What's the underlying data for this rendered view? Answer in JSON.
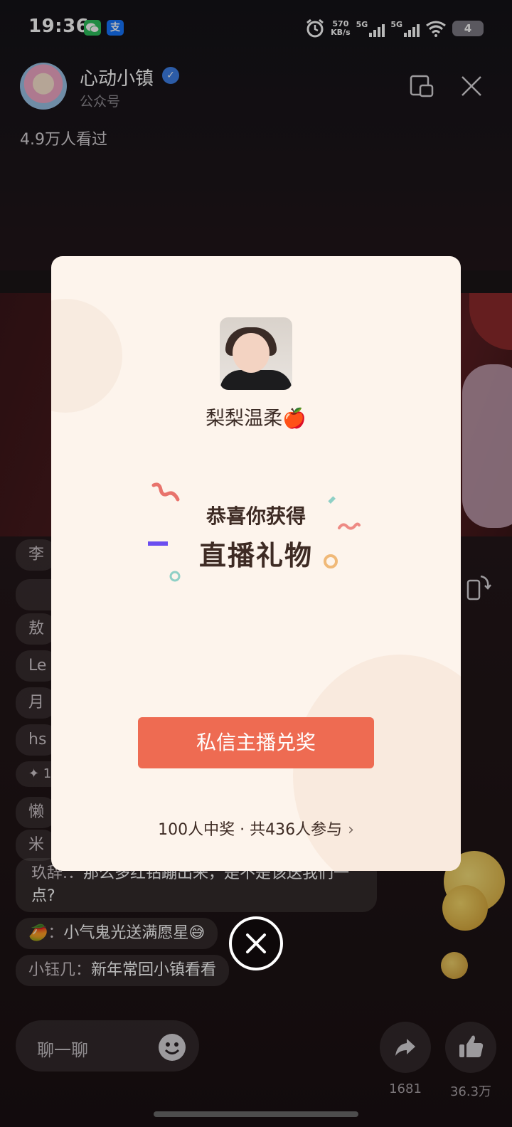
{
  "status_bar": {
    "time": "19:36",
    "wechat_icon": "wechat-icon",
    "alipay_label": "支",
    "speed_value": "570",
    "speed_unit": "KB/s",
    "net1": "5G",
    "net2": "5G",
    "battery": "4"
  },
  "header": {
    "channel_name": "心动小镇",
    "channel_sub": "公众号",
    "views": "4.9万人看过"
  },
  "chat": {
    "items": [
      {
        "who": "李"
      },
      {
        "who": "敖"
      },
      {
        "who": "Le"
      },
      {
        "who": "月"
      },
      {
        "who": "hs"
      },
      {
        "who": "✦ 1"
      },
      {
        "who": "懒"
      },
      {
        "who": "米"
      },
      {
        "who": "玖辞.：",
        "msg": "那么多红钻蹦出来，是不是该送我们一点?"
      },
      {
        "who": "🥭：",
        "msg": "小气鬼光送满愿星😅"
      },
      {
        "who": "小钰几：",
        "msg": "新年常回小镇看看"
      }
    ]
  },
  "bottom_bar": {
    "input_placeholder": "聊一聊",
    "share_count": "1681",
    "like_count": "36.3万"
  },
  "modal": {
    "host_name": "梨梨温柔🍎",
    "congrats": "恭喜你获得",
    "prize": "直播礼物",
    "claim_button": "私信主播兑奖",
    "stats": "100人中奖 · 共436人参与",
    "stats_chevron": "›"
  },
  "colors": {
    "accent": "#ee6b52",
    "modal_bg": "#fdf4ec",
    "text_dark": "#3e2b24",
    "verified": "#3d80e8"
  }
}
